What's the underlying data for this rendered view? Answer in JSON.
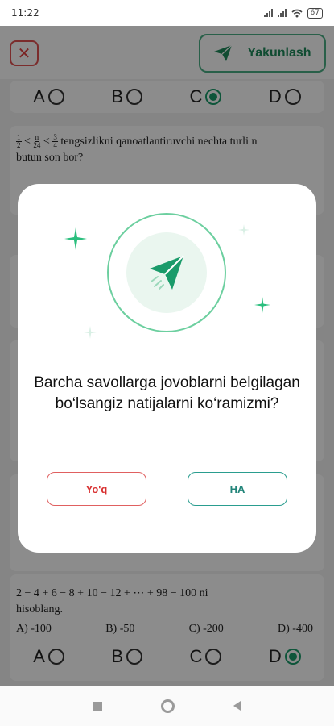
{
  "status_bar": {
    "time": "11:22",
    "battery": "67"
  },
  "header": {
    "close_symbol": "✕",
    "finish_label": "Yakunlash"
  },
  "question_top_options": {
    "letters": [
      "A",
      "B",
      "C",
      "D"
    ],
    "selected": "C"
  },
  "question_fraction": {
    "frac1_num": "1",
    "frac1_den": "2",
    "frac2_num": "n",
    "frac2_den": "24",
    "frac3_num": "3",
    "frac3_den": "4",
    "text_line1": "tengsizlikni qanoatlantiruvchi nechta turli n",
    "text_line2": "butun son bor?"
  },
  "question_bottom": {
    "text_line1": "2 − 4 + 6 − 8 + 10 − 12 + ⋯ + 98 − 100  ni",
    "text_line2": "hisoblang.",
    "answers": [
      "A) -100",
      "B) -50",
      "C) -200",
      "D) -400"
    ],
    "letters": [
      "A",
      "B",
      "C",
      "D"
    ],
    "selected": "D"
  },
  "dialog": {
    "message": "Barcha savollarga jovoblarni belgilagan bo‘lsangiz natijalarni ko‘ramizmi?",
    "no_label": "Yo'q",
    "yes_label": "HA"
  },
  "colors": {
    "accent_green": "#1a9b6a",
    "danger_red": "#d83030",
    "teal": "#23857a"
  }
}
